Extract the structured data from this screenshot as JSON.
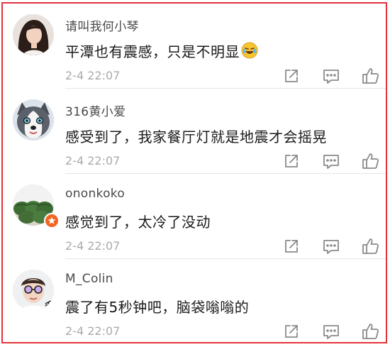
{
  "colors": {
    "frame": "#e2333a",
    "username": "#4a4a4a",
    "text": "#1a1a1a",
    "time": "#aaaaaa",
    "icon": "#8a8a8a",
    "badge": "#f26522"
  },
  "comments": [
    {
      "avatar": "avatar-woman-long-hair",
      "username": "请叫我何小琴",
      "text": "平潭也有震感，只是不明显",
      "emoji": "crying-laughing-emoji",
      "time": "2-4 22:07"
    },
    {
      "avatar": "avatar-husky-dog",
      "username": "316黄小爱",
      "text": "感受到了，我家餐厅灯就是地震才会摇晃",
      "time": "2-4 22:07"
    },
    {
      "avatar": "avatar-watermelons",
      "badge": "verified-badge-orange",
      "username": "ononkoko",
      "text": "感觉到了，太冷了没动",
      "time": "2-4 22:07"
    },
    {
      "avatar": "avatar-man-sunglasses",
      "username": "M_Colin",
      "text": "震了有5秒钟吧，脑袋嗡嗡的",
      "time": "2-4 22:07"
    }
  ],
  "actions": {
    "share_icon": "share-icon",
    "reply_icon": "comment-icon",
    "like_icon": "thumbs-up-icon"
  }
}
